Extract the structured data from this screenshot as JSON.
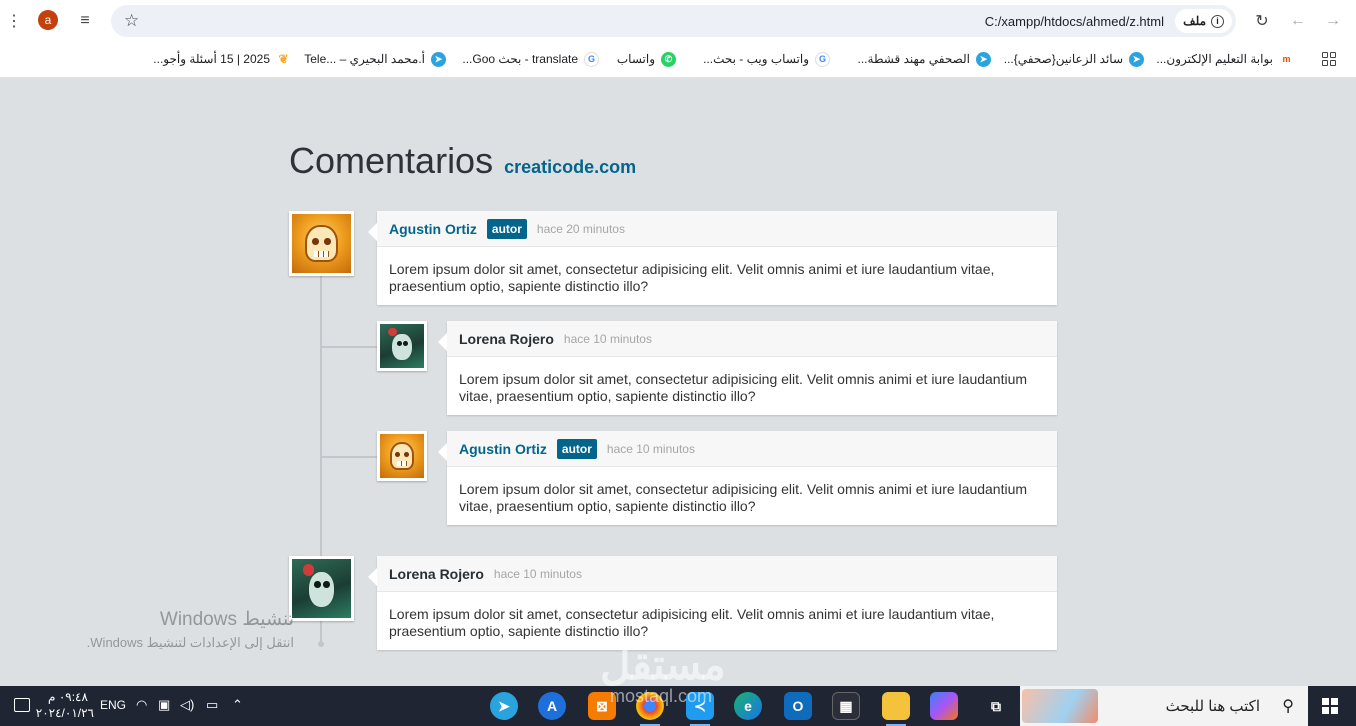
{
  "browser": {
    "profile_initial": "a",
    "url": "C:/xampp/htdocs/ahmed/z.html",
    "site_chip": "ملف",
    "bookmarks": [
      {
        "label": "بوابة التعليم الإلكترون...",
        "icon": "moodle-icon"
      },
      {
        "label": "سائد الزعانين{صحفي}...",
        "icon": "telegram-icon"
      },
      {
        "label": "الصحفي مهند قشطة...",
        "icon": "telegram-icon"
      },
      {
        "label": "واتساب ويب - بحث...",
        "icon": "google-icon"
      },
      {
        "label": "واتساب",
        "icon": "whatsapp-icon"
      },
      {
        "label": "translate - بحث Goo...",
        "icon": "google-icon"
      },
      {
        "label": "أ.محمد البحيري – ...Tele",
        "icon": "telegram-icon"
      },
      {
        "label": "2025 | 15 أسئلة وأجو...",
        "icon": "leaf-icon"
      }
    ]
  },
  "page": {
    "title": "Comentarios",
    "site_link": "creaticode.com"
  },
  "comments": [
    {
      "name": "Agustin Ortiz",
      "badge": "autor",
      "time": "hace 20 minutos",
      "text": "Lorem ipsum dolor sit amet, consectetur adipisicing elit. Velit omnis animi et iure laudantium vitae, praesentium optio, sapiente distinctio illo?",
      "avatar": "skull-avatar"
    },
    {
      "name": "Lorena Rojero",
      "badge": "",
      "time": "hace 10 minutos",
      "text": "Lorem ipsum dolor sit amet, consectetur adipisicing elit. Velit omnis animi et iure laudantium vitae, praesentium optio, sapiente distinctio illo?",
      "avatar": "catrina-avatar"
    },
    {
      "name": "Agustin Ortiz",
      "badge": "autor",
      "time": "hace 10 minutos",
      "text": "Lorem ipsum dolor sit amet, consectetur adipisicing elit. Velit omnis animi et iure laudantium vitae, praesentium optio, sapiente distinctio illo?",
      "avatar": "skull-avatar"
    },
    {
      "name": "Lorena Rojero",
      "badge": "",
      "time": "hace 10 minutos",
      "text": "Lorem ipsum dolor sit amet, consectetur adipisicing elit. Velit omnis animi et iure laudantium vitae, praesentium optio, sapiente distinctio illo?",
      "avatar": "catrina-avatar"
    }
  ],
  "watermark": {
    "line1": "تنشيط Windows",
    "line2": "انتقل إلى الإعدادات لتنشيط Windows.",
    "brand_ar": "مستقل",
    "brand_en": "mostaql.com"
  },
  "taskbar": {
    "time": "٠٩:٤٨ م",
    "date": "٢٠٢٤/٠١/٢٦",
    "language": "ENG",
    "search_placeholder": "اكتب هنا للبحث"
  },
  "colors": {
    "accent": "#03658c",
    "page_bg": "#dde0e3",
    "taskbar_bg": "#1f2533"
  }
}
